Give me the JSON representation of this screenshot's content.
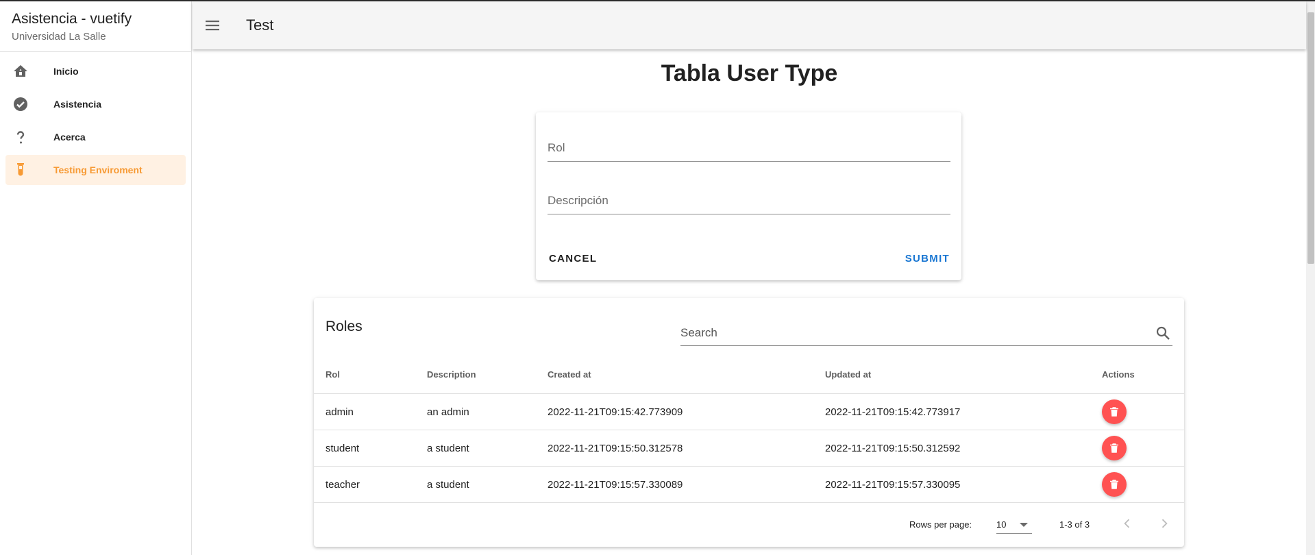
{
  "sidebar": {
    "title": "Asistencia - vuetify",
    "subtitle": "Universidad La Salle",
    "items": [
      {
        "label": "Inicio",
        "icon": "home-icon"
      },
      {
        "label": "Asistencia",
        "icon": "check-circle-icon"
      },
      {
        "label": "Acerca",
        "icon": "help-icon"
      },
      {
        "label": "Testing Enviroment",
        "icon": "test-tube-icon",
        "active": true
      }
    ]
  },
  "appbar": {
    "title": "Test",
    "menu_icon": "menu-icon"
  },
  "page": {
    "title": "Tabla User Type"
  },
  "form": {
    "rol_placeholder": "Rol",
    "descripcion_placeholder": "Descripción",
    "cancel_label": "CANCEL",
    "submit_label": "SUBMIT"
  },
  "table": {
    "title": "Roles",
    "search_placeholder": "Search",
    "headers": [
      "Rol",
      "Description",
      "Created at",
      "Updated at",
      "Actions"
    ],
    "rows": [
      {
        "rol": "admin",
        "description": "an admin",
        "created_at": "2022-11-21T09:15:42.773909",
        "updated_at": "2022-11-21T09:15:42.773917"
      },
      {
        "rol": "student",
        "description": "a student",
        "created_at": "2022-11-21T09:15:50.312578",
        "updated_at": "2022-11-21T09:15:50.312592"
      },
      {
        "rol": "teacher",
        "description": "a student",
        "created_at": "2022-11-21T09:15:57.330089",
        "updated_at": "2022-11-21T09:15:57.330095"
      }
    ],
    "footer": {
      "rows_per_page_label": "Rows per page:",
      "rows_per_page_value": "10",
      "range_text": "1-3 of 3"
    }
  },
  "colors": {
    "accent": "#f79a34",
    "active_bg": "#fff1e3",
    "submit": "#1976d2",
    "delete": "#ff5252"
  }
}
